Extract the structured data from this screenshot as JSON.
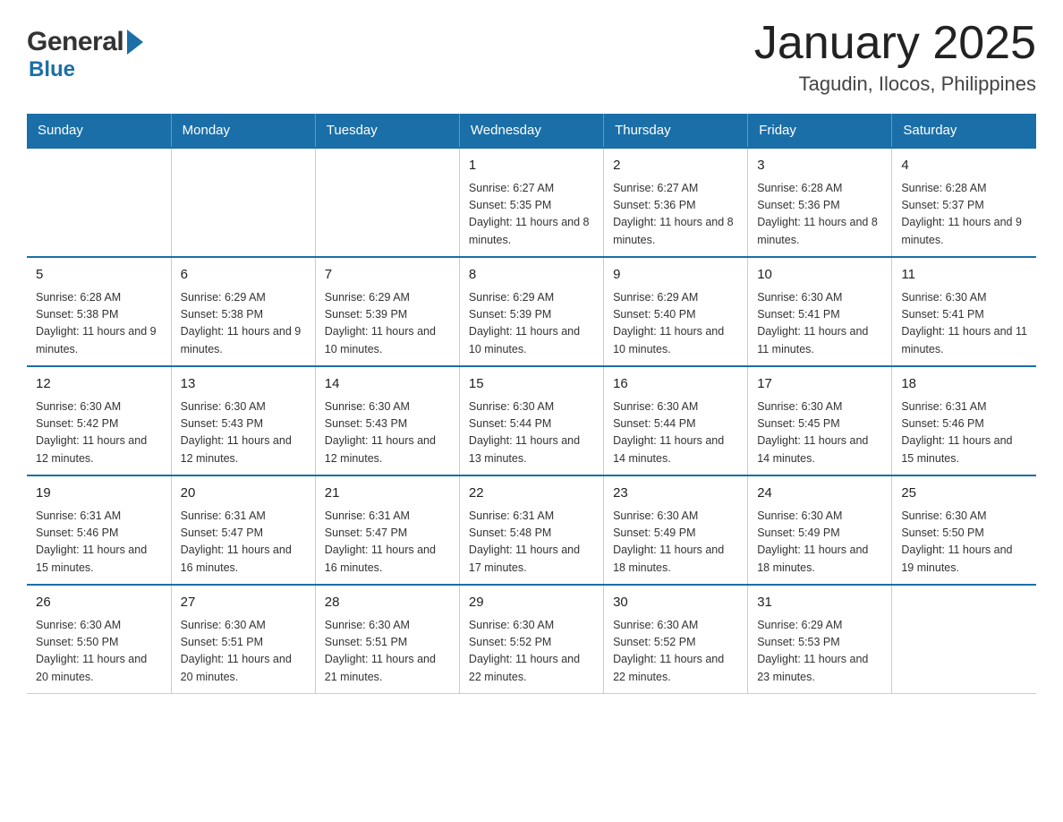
{
  "logo": {
    "general": "General",
    "blue": "Blue"
  },
  "title": "January 2025",
  "subtitle": "Tagudin, Ilocos, Philippines",
  "weekdays": [
    "Sunday",
    "Monday",
    "Tuesday",
    "Wednesday",
    "Thursday",
    "Friday",
    "Saturday"
  ],
  "weeks": [
    [
      {
        "day": "",
        "info": ""
      },
      {
        "day": "",
        "info": ""
      },
      {
        "day": "",
        "info": ""
      },
      {
        "day": "1",
        "info": "Sunrise: 6:27 AM\nSunset: 5:35 PM\nDaylight: 11 hours\nand 8 minutes."
      },
      {
        "day": "2",
        "info": "Sunrise: 6:27 AM\nSunset: 5:36 PM\nDaylight: 11 hours\nand 8 minutes."
      },
      {
        "day": "3",
        "info": "Sunrise: 6:28 AM\nSunset: 5:36 PM\nDaylight: 11 hours\nand 8 minutes."
      },
      {
        "day": "4",
        "info": "Sunrise: 6:28 AM\nSunset: 5:37 PM\nDaylight: 11 hours\nand 9 minutes."
      }
    ],
    [
      {
        "day": "5",
        "info": "Sunrise: 6:28 AM\nSunset: 5:38 PM\nDaylight: 11 hours\nand 9 minutes."
      },
      {
        "day": "6",
        "info": "Sunrise: 6:29 AM\nSunset: 5:38 PM\nDaylight: 11 hours\nand 9 minutes."
      },
      {
        "day": "7",
        "info": "Sunrise: 6:29 AM\nSunset: 5:39 PM\nDaylight: 11 hours\nand 10 minutes."
      },
      {
        "day": "8",
        "info": "Sunrise: 6:29 AM\nSunset: 5:39 PM\nDaylight: 11 hours\nand 10 minutes."
      },
      {
        "day": "9",
        "info": "Sunrise: 6:29 AM\nSunset: 5:40 PM\nDaylight: 11 hours\nand 10 minutes."
      },
      {
        "day": "10",
        "info": "Sunrise: 6:30 AM\nSunset: 5:41 PM\nDaylight: 11 hours\nand 11 minutes."
      },
      {
        "day": "11",
        "info": "Sunrise: 6:30 AM\nSunset: 5:41 PM\nDaylight: 11 hours\nand 11 minutes."
      }
    ],
    [
      {
        "day": "12",
        "info": "Sunrise: 6:30 AM\nSunset: 5:42 PM\nDaylight: 11 hours\nand 12 minutes."
      },
      {
        "day": "13",
        "info": "Sunrise: 6:30 AM\nSunset: 5:43 PM\nDaylight: 11 hours\nand 12 minutes."
      },
      {
        "day": "14",
        "info": "Sunrise: 6:30 AM\nSunset: 5:43 PM\nDaylight: 11 hours\nand 12 minutes."
      },
      {
        "day": "15",
        "info": "Sunrise: 6:30 AM\nSunset: 5:44 PM\nDaylight: 11 hours\nand 13 minutes."
      },
      {
        "day": "16",
        "info": "Sunrise: 6:30 AM\nSunset: 5:44 PM\nDaylight: 11 hours\nand 14 minutes."
      },
      {
        "day": "17",
        "info": "Sunrise: 6:30 AM\nSunset: 5:45 PM\nDaylight: 11 hours\nand 14 minutes."
      },
      {
        "day": "18",
        "info": "Sunrise: 6:31 AM\nSunset: 5:46 PM\nDaylight: 11 hours\nand 15 minutes."
      }
    ],
    [
      {
        "day": "19",
        "info": "Sunrise: 6:31 AM\nSunset: 5:46 PM\nDaylight: 11 hours\nand 15 minutes."
      },
      {
        "day": "20",
        "info": "Sunrise: 6:31 AM\nSunset: 5:47 PM\nDaylight: 11 hours\nand 16 minutes."
      },
      {
        "day": "21",
        "info": "Sunrise: 6:31 AM\nSunset: 5:47 PM\nDaylight: 11 hours\nand 16 minutes."
      },
      {
        "day": "22",
        "info": "Sunrise: 6:31 AM\nSunset: 5:48 PM\nDaylight: 11 hours\nand 17 minutes."
      },
      {
        "day": "23",
        "info": "Sunrise: 6:30 AM\nSunset: 5:49 PM\nDaylight: 11 hours\nand 18 minutes."
      },
      {
        "day": "24",
        "info": "Sunrise: 6:30 AM\nSunset: 5:49 PM\nDaylight: 11 hours\nand 18 minutes."
      },
      {
        "day": "25",
        "info": "Sunrise: 6:30 AM\nSunset: 5:50 PM\nDaylight: 11 hours\nand 19 minutes."
      }
    ],
    [
      {
        "day": "26",
        "info": "Sunrise: 6:30 AM\nSunset: 5:50 PM\nDaylight: 11 hours\nand 20 minutes."
      },
      {
        "day": "27",
        "info": "Sunrise: 6:30 AM\nSunset: 5:51 PM\nDaylight: 11 hours\nand 20 minutes."
      },
      {
        "day": "28",
        "info": "Sunrise: 6:30 AM\nSunset: 5:51 PM\nDaylight: 11 hours\nand 21 minutes."
      },
      {
        "day": "29",
        "info": "Sunrise: 6:30 AM\nSunset: 5:52 PM\nDaylight: 11 hours\nand 22 minutes."
      },
      {
        "day": "30",
        "info": "Sunrise: 6:30 AM\nSunset: 5:52 PM\nDaylight: 11 hours\nand 22 minutes."
      },
      {
        "day": "31",
        "info": "Sunrise: 6:29 AM\nSunset: 5:53 PM\nDaylight: 11 hours\nand 23 minutes."
      },
      {
        "day": "",
        "info": ""
      }
    ]
  ]
}
